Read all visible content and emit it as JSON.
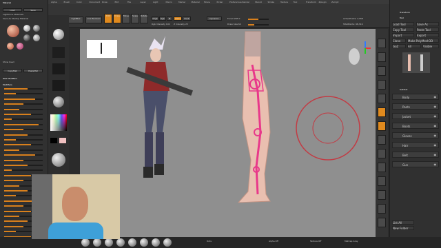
{
  "menu": {
    "items": [
      "Alpha",
      "Brush",
      "Color",
      "Document",
      "Draw",
      "Edit",
      "File",
      "Layer",
      "Light",
      "Macro",
      "Marker",
      "Material",
      "Movie",
      "Picker",
      "Preferences",
      "Render",
      "Stencil",
      "Stroke",
      "Texture",
      "Tool",
      "Transform",
      "Zplugin",
      "Zscript"
    ]
  },
  "left_panel": {
    "title": "Material",
    "load_label": "Load",
    "save_label": "Save",
    "lightbox_label": "Lightbox ▸ Materials",
    "save_as_startup_label": "Save As Startup Material",
    "show_used_label": "Show Used",
    "copymat_label": "CopyMat",
    "pastemat_label": "PasteMat",
    "wax_modifiers_label": "Wax Modifiers",
    "modifiers_label": "Modifiers"
  },
  "tools": {
    "home_page": "Home Page",
    "lightbox": "LightBox",
    "live_boolean": "Live Boolean",
    "edit": "Edit",
    "draw": "Draw",
    "move": "Move",
    "scale": "Scale",
    "rotate": "Rotate",
    "mrgb": "Mrgb",
    "rgb": "Rgb",
    "m": "M",
    "zadd": "Zadd",
    "zsub": "Zsub",
    "focal_shift": "Focal Shift 0",
    "draw_size": "Draw Size 64",
    "dynamic": "Dynamic",
    "z_intensity": "Z Intensity 25",
    "rgb_intensity": "Rgb Intensity 100",
    "active_points": "ActivePoints: 4,958",
    "total_points": "TotalPoints: 98,316"
  },
  "right_panel": {
    "transform_label": "Transform",
    "tool_label": "Tool",
    "load_tool": "Load Tool",
    "save_as": "Save As",
    "copy_tool": "Copy Tool",
    "paste_tool": "Paste Tool",
    "import": "Import",
    "export": "Export",
    "clone": "Clone",
    "make_polymesh": "Make PolyMesh3D",
    "goz": "GoZ",
    "all": "All",
    "visible": "Visible",
    "subtool_label": "Subtool",
    "subtools": [
      "Body",
      "Pants",
      "Jacket",
      "Boots",
      "Gloves",
      "Hair",
      "Belt",
      "Gun"
    ],
    "list_all": "List All",
    "new_folder": "New Folder"
  },
  "bottom": {
    "brushes": [
      "Standard",
      "ClayBuildup",
      "Move",
      "DamStandard",
      "hPolish",
      "TrimDynamic",
      "Inflat",
      "Pinch"
    ],
    "dots": "Dots",
    "alpha_off": "Alpha Off",
    "texture_off": "Texture Off",
    "matcap": "MatCap Gray"
  },
  "colors": {
    "accent": "#e08a1e",
    "viewport_bg": "#8f8f8f",
    "skeleton": "#e8388a"
  }
}
